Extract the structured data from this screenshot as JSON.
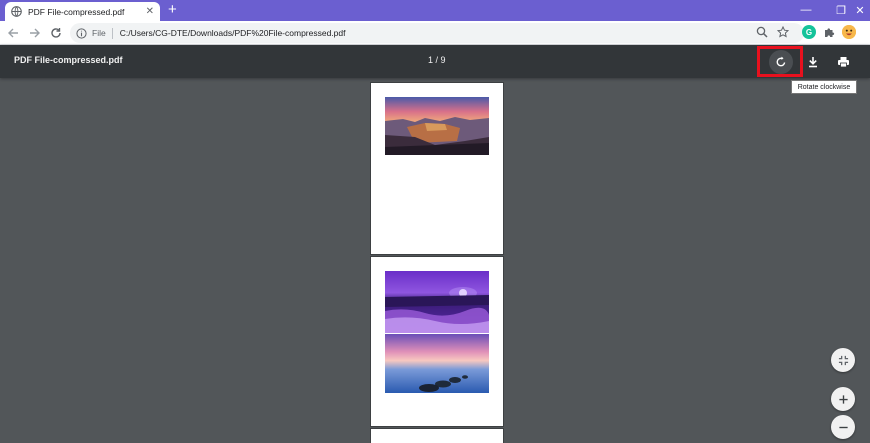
{
  "browser": {
    "tab_title": "PDF File-compressed.pdf",
    "close_glyph": "✕",
    "new_tab_glyph": "+",
    "window": {
      "minimize": "—",
      "maximize": "❐",
      "close": "✕"
    },
    "omnibox": {
      "scheme_label": "File",
      "url": "C:/Users/CG-DTE/Downloads/PDF%20File-compressed.pdf"
    },
    "extensions": {
      "grammarly_letter": "G"
    }
  },
  "viewer": {
    "title": "PDF File-compressed.pdf",
    "page_indicator": "1 / 9",
    "tooltip": "Rotate clockwise",
    "icons": [
      "rotate-clockwise-icon",
      "download-icon",
      "print-icon",
      "fit-to-page-icon",
      "zoom-in-icon",
      "zoom-out-icon"
    ]
  },
  "colors": {
    "tabstrip": "#6b5fd0",
    "pdf_toolbar": "#323639",
    "viewer_background": "#525659",
    "highlight": "#e8111e"
  }
}
